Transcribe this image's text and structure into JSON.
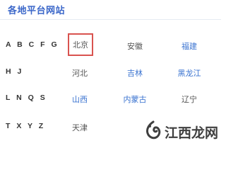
{
  "header": {
    "title": "各地平台网站"
  },
  "groups": [
    {
      "label": "A B C F G",
      "sites": [
        {
          "name": "北京",
          "style": "selected"
        },
        {
          "name": "安徽",
          "style": "plain"
        },
        {
          "name": "福建",
          "style": "link"
        }
      ]
    },
    {
      "label": "H J",
      "sites": [
        {
          "name": "河北",
          "style": "plain"
        },
        {
          "name": "吉林",
          "style": "link"
        },
        {
          "name": "黑龙江",
          "style": "link"
        }
      ]
    },
    {
      "label": "L N Q S",
      "sites": [
        {
          "name": "山西",
          "style": "link"
        },
        {
          "name": "内蒙古",
          "style": "link"
        },
        {
          "name": "辽宁",
          "style": "plain"
        }
      ]
    },
    {
      "label": "T X Y Z",
      "sites": [
        {
          "name": "天津",
          "style": "plain"
        },
        {
          "name": "",
          "style": "plain"
        },
        {
          "name": "",
          "style": "plain"
        }
      ]
    }
  ],
  "watermark": {
    "text": "江西龙网"
  },
  "colors": {
    "accent": "#3a73d0",
    "title": "#3b67c9",
    "selected_border": "#d9534f",
    "plain_text": "#555555"
  }
}
